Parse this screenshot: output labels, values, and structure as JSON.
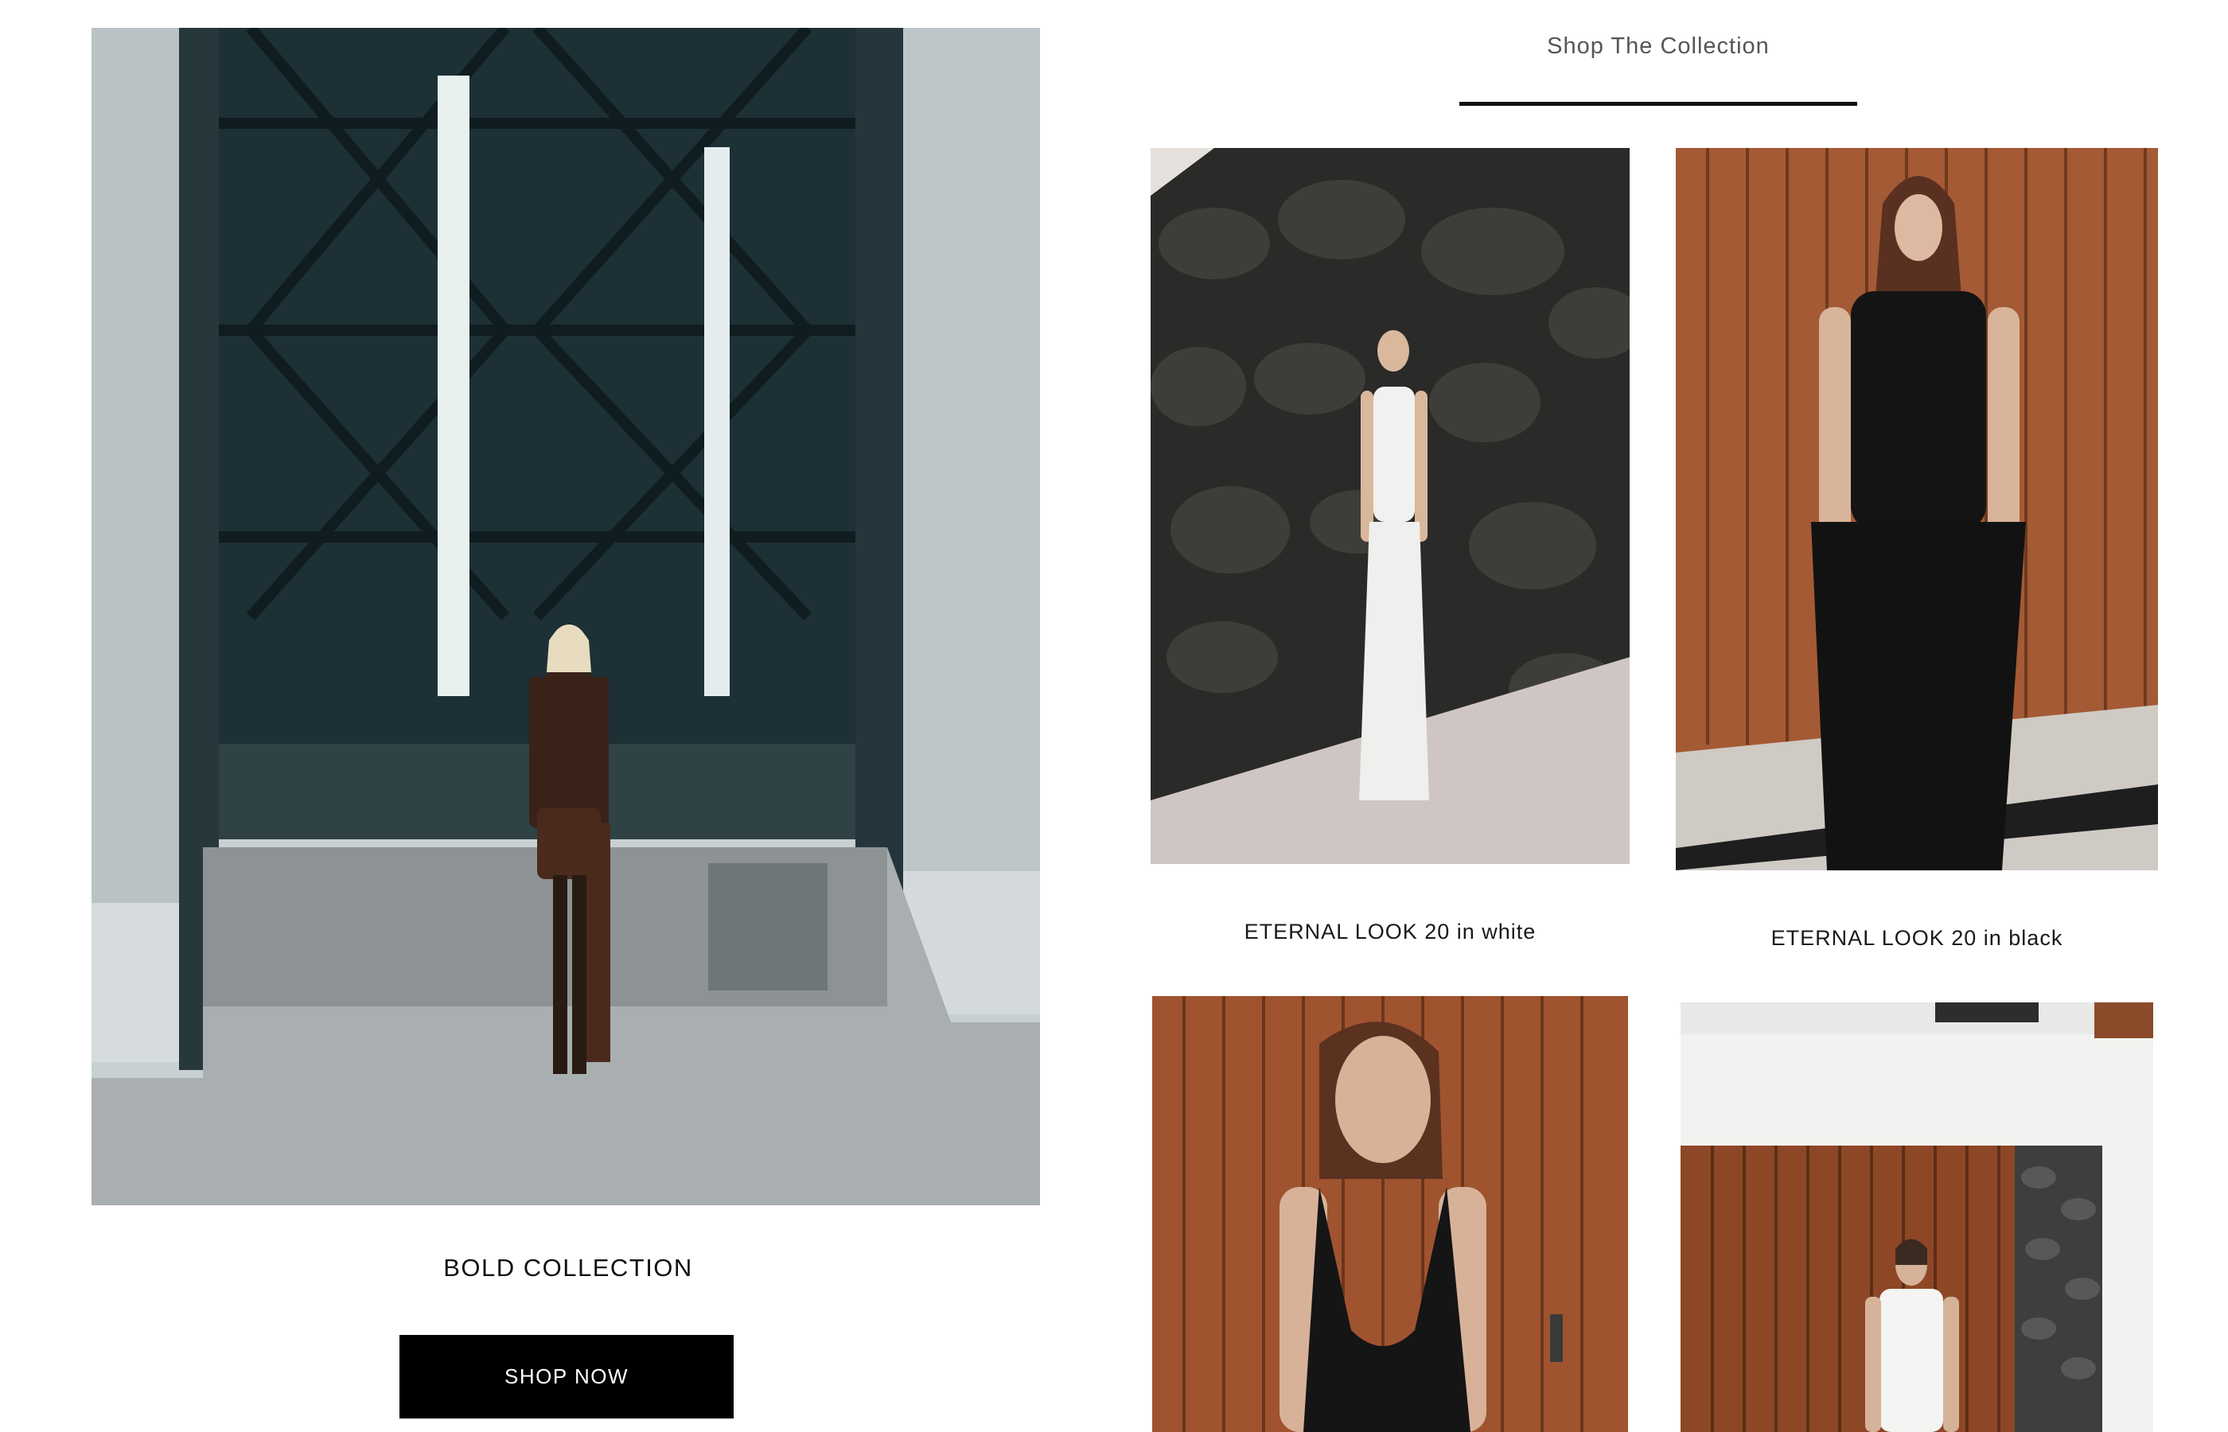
{
  "hero": {
    "collection_title": "BOLD COLLECTION",
    "cta_label": "SHOP NOW"
  },
  "shop": {
    "section_title": "Shop The Collection",
    "products": [
      {
        "caption": "ETERNAL LOOK 20 in white"
      },
      {
        "caption": "ETERNAL LOOK 20 in black"
      },
      {
        "caption": ""
      },
      {
        "caption": ""
      }
    ]
  },
  "colors": {
    "button_bg": "#000000",
    "button_text": "#ffffff",
    "underline": "#111111"
  }
}
